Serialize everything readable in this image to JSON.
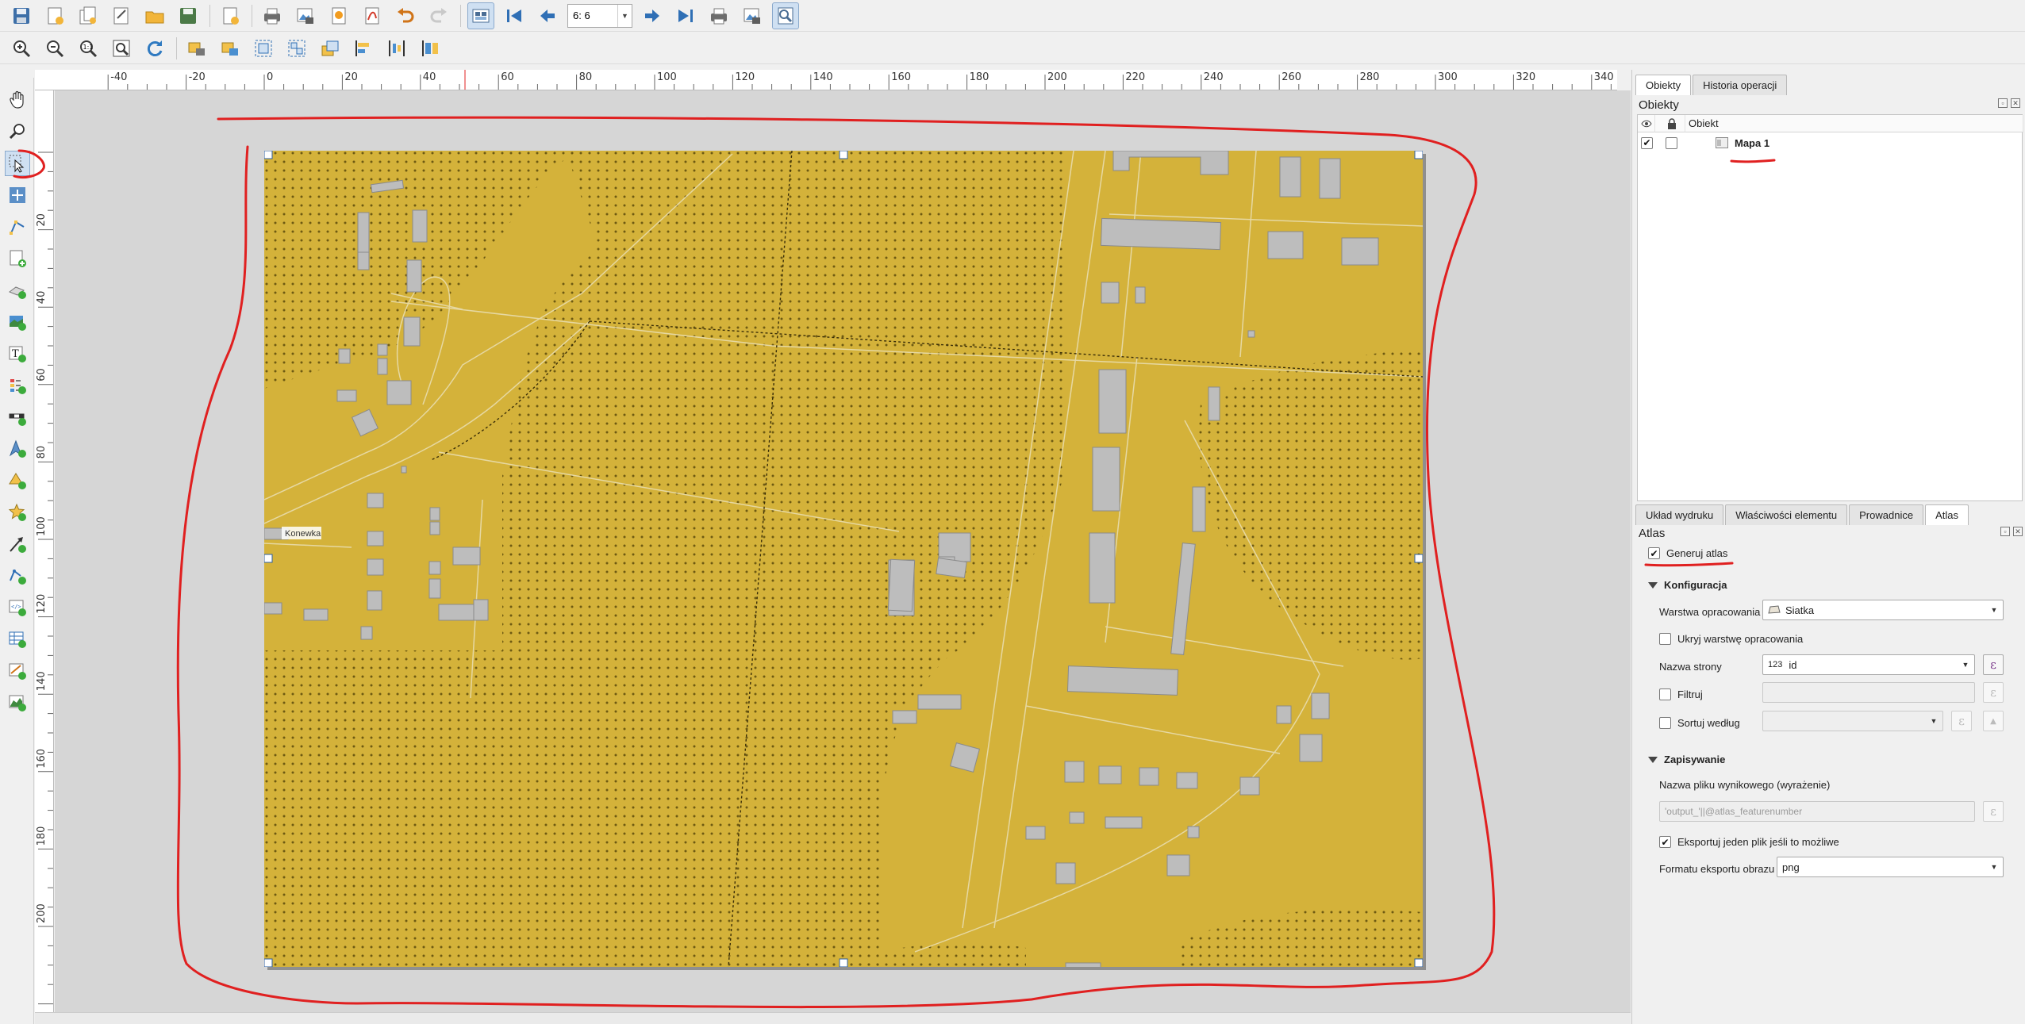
{
  "toolbar": {
    "page_field_value": "6: 6",
    "row1_icons": [
      "save-layout-icon",
      "new-layout-icon",
      "duplicate-layout-icon",
      "layout-manager-icon",
      "open-template-icon",
      "save-template-icon",
      "add-page-icon",
      "print-icon",
      "export-image-icon",
      "export-svg-icon",
      "export-pdf-icon",
      "undo-icon",
      "redo-icon"
    ],
    "atlas_icons": [
      "atlas-preview-icon",
      "first-feature-icon",
      "previous-feature-icon",
      "next-feature-icon",
      "last-feature-icon",
      "print-atlas-icon",
      "export-atlas-icon",
      "atlas-settings-icon"
    ],
    "row2_icons": [
      "zoom-in-icon",
      "zoom-out-icon",
      "zoom-actual-icon",
      "zoom-full-icon",
      "refresh-icon",
      "lock-items-icon",
      "unlock-items-icon",
      "group-items-icon",
      "ungroup-items-icon",
      "raise-items-icon",
      "align-left-icon",
      "distribute-icon",
      "resize-icon"
    ]
  },
  "toolbox": {
    "tools": [
      "pan-icon",
      "zoom-tool-icon",
      "select-move-icon",
      "move-content-icon",
      "edit-nodes-icon",
      "add-map-icon",
      "add-3d-map-icon",
      "add-picture-icon",
      "add-label-icon",
      "add-legend-icon",
      "add-scalebar-icon",
      "add-north-arrow-icon",
      "add-shape-icon",
      "add-marker-icon",
      "add-arrow-icon",
      "add-node-item-icon",
      "add-html-icon",
      "add-attribute-table-icon",
      "add-fixed-table-icon",
      "add-elevation-profile-icon"
    ]
  },
  "rulers": {
    "horizontal": [
      "-40",
      "-20",
      "0",
      "20",
      "40",
      "60",
      "80",
      "100",
      "120",
      "140",
      "160",
      "180",
      "200",
      "220",
      "240",
      "260",
      "280",
      "300",
      "320",
      "340"
    ],
    "vertical": [
      "20",
      "40",
      "60",
      "80",
      "100",
      "120",
      "140",
      "160",
      "180",
      "200"
    ]
  },
  "map": {
    "place_label": "Konewka",
    "background_color": "#d4b23a",
    "building_color": "#bdbdbd"
  },
  "items_panel": {
    "tabs": [
      "Obiekty",
      "Historia operacji"
    ],
    "title": "Obiekty",
    "column_object": "Obiekt",
    "rows": [
      {
        "name": "Mapa 1",
        "visible": true,
        "locked": false
      }
    ]
  },
  "props_panel": {
    "tabs": [
      "Układ wydruku",
      "Właściwości elementu",
      "Prowadnice",
      "Atlas"
    ],
    "active_tab": "Atlas",
    "title": "Atlas",
    "generate_atlas_label": "Generuj atlas",
    "generate_atlas_checked": true,
    "config_group": "Konfiguracja",
    "coverage_layer_label": "Warstwa opracowania",
    "coverage_layer_value": "Siatka",
    "hide_coverage_label": "Ukryj warstwę opracowania",
    "page_name_label": "Nazwa strony",
    "page_name_type": "123",
    "page_name_value": "id",
    "filter_label": "Filtruj",
    "sort_label": "Sortuj według",
    "output_group": "Zapisywanie",
    "output_filename_label": "Nazwa pliku wynikowego (wyrażenie)",
    "output_filename_value": "'output_'||@atlas_featurenumber",
    "single_file_label": "Eksportuj jeden plik jeśli to możliwe",
    "single_file_checked": true,
    "image_format_label": "Formatu eksportu obrazu",
    "image_format_value": "png"
  },
  "expr_symbol": "ε",
  "annotation_color": "#e02020"
}
